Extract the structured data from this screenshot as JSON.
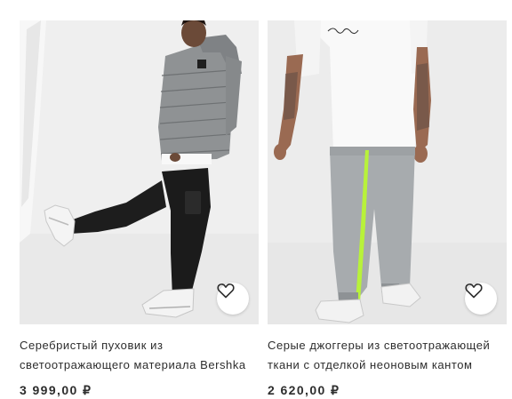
{
  "products": [
    {
      "title": "Серебристый пуховик из светоотражающего материала Bershka",
      "price": "3 999,00 ₽",
      "wishlist_icon": "heart-outline-icon"
    },
    {
      "title": "Серые джоггеры из светоотражающей ткани с отделкой неоновым кантом",
      "price": "2 620,00 ₽",
      "wishlist_icon": "heart-outline-icon"
    }
  ],
  "colors": {
    "text": "#2d2d2d",
    "photo_background": "#ededed",
    "neon_trim": "#b8f23a"
  }
}
